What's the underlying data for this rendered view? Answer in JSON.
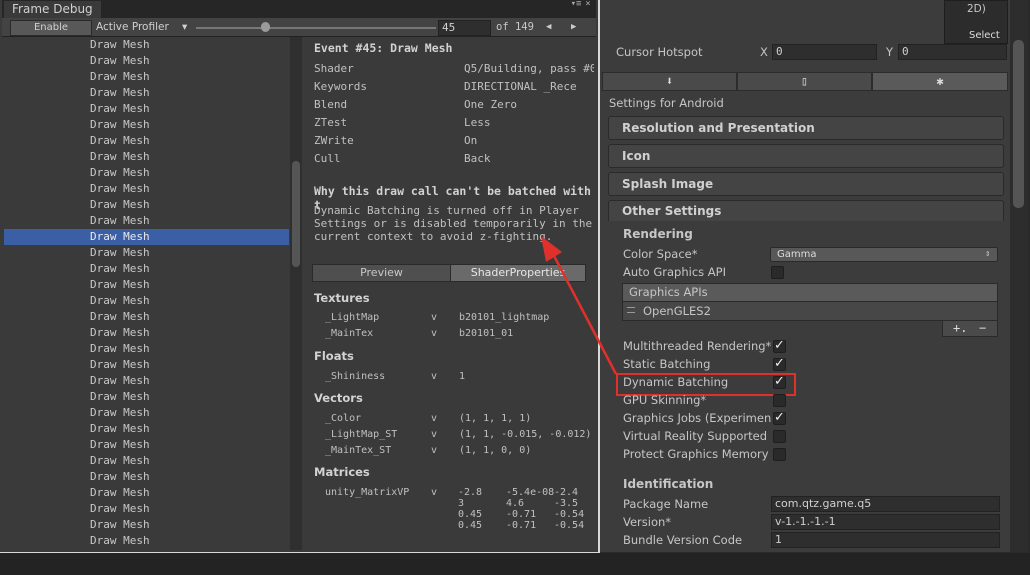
{
  "frame_debug": {
    "tab_title": "Frame Debug",
    "enable_label": "Enable",
    "profiler_label": "Active Profiler",
    "profiler_caret": "▾",
    "event_index": "45",
    "event_total": "of 149",
    "prev_arrow": "◀",
    "next_arrow": "▶",
    "list_item_label": "Draw Mesh",
    "list_count": 32,
    "selected_index": 12,
    "details": {
      "event_title": "Event #45: Draw Mesh",
      "props": [
        {
          "k": "Shader",
          "v": "Q5/Building, pass #0"
        },
        {
          "k": "Keywords",
          "v": "DIRECTIONAL _Rece"
        },
        {
          "k": "Blend",
          "v": "One Zero"
        },
        {
          "k": "ZTest",
          "v": "Less"
        },
        {
          "k": "ZWrite",
          "v": "On"
        },
        {
          "k": "Cull",
          "v": "Back"
        }
      ],
      "batch_heading": "Why this draw call can't be batched with t",
      "batch_reason_lines": [
        "Dynamic Batching is turned off in Player",
        "Settings or is disabled temporarily in the",
        "current context to avoid z-fighting."
      ],
      "tab_preview": "Preview",
      "tab_shader": "ShaderProperties",
      "textures_heading": "Textures",
      "textures": [
        {
          "name": "_LightMap",
          "stage": "v",
          "value": "b20101_lightmap"
        },
        {
          "name": "_MainTex",
          "stage": "v",
          "value": "b20101_01"
        }
      ],
      "floats_heading": "Floats",
      "floats": [
        {
          "name": "_Shininess",
          "stage": "v",
          "value": "1"
        }
      ],
      "vectors_heading": "Vectors",
      "vectors": [
        {
          "name": "_Color",
          "stage": "v",
          "value": "(1, 1, 1, 1)"
        },
        {
          "name": "_LightMap_ST",
          "stage": "v",
          "value": "(1, 1, -0.015, -0.012)"
        },
        {
          "name": "_MainTex_ST",
          "stage": "v",
          "value": "(1, 1, 0, 0)"
        }
      ],
      "matrices_heading": "Matrices",
      "matrix": {
        "name": "unity_MatrixVP",
        "stage": "v",
        "rows": [
          [
            "-2.8",
            "-5.4e-08",
            "-2.4"
          ],
          [
            "3",
            "4.6",
            "-3.5"
          ],
          [
            "0.45",
            "-0.71",
            "-0.54"
          ],
          [
            "0.45",
            "-0.71",
            "-0.54"
          ]
        ]
      }
    }
  },
  "inspector": {
    "preview_line1": "2D)",
    "select_label": "Select",
    "cursor_hotspot_label": "Cursor Hotspot",
    "x_label": "X",
    "x_value": "0",
    "y_label": "Y",
    "y_value": "0",
    "tab_download_icon": "⬇",
    "tab_mobile_icon": "▯",
    "tab_android_icon": "✱",
    "settings_for": "Settings for Android",
    "sections": [
      "Resolution and Presentation",
      "Icon",
      "Splash Image"
    ],
    "other_settings": "Other Settings",
    "rendering_heading": "Rendering",
    "color_space_label": "Color Space*",
    "color_space_value": "Gamma",
    "color_space_caret": "⇕",
    "auto_gfx_label": "Auto Graphics API",
    "graphics_apis_label": "Graphics APIs",
    "opengles": "OpenGLES2",
    "plus": "+.",
    "minus": "−",
    "rendering_toggles": [
      {
        "label": "Multithreaded Rendering*",
        "on": true
      },
      {
        "label": "Static Batching",
        "on": true
      },
      {
        "label": "Dynamic Batching",
        "on": true
      },
      {
        "label": "GPU Skinning*",
        "on": false
      },
      {
        "label": "Graphics Jobs (Experimen",
        "on": true
      },
      {
        "label": "Virtual Reality Supported",
        "on": false
      },
      {
        "label": "Protect Graphics Memory",
        "on": false
      }
    ],
    "identification_heading": "Identification",
    "package_name_label": "Package Name",
    "package_name_value": "com.qtz.game.q5",
    "version_label": "Version*",
    "version_value": "v-1.-1.-1.-1",
    "bundle_label": "Bundle Version Code",
    "bundle_value": "1"
  },
  "colors": {
    "highlight_red": "#e0302c",
    "selection_blue": "#3b5fa5"
  }
}
